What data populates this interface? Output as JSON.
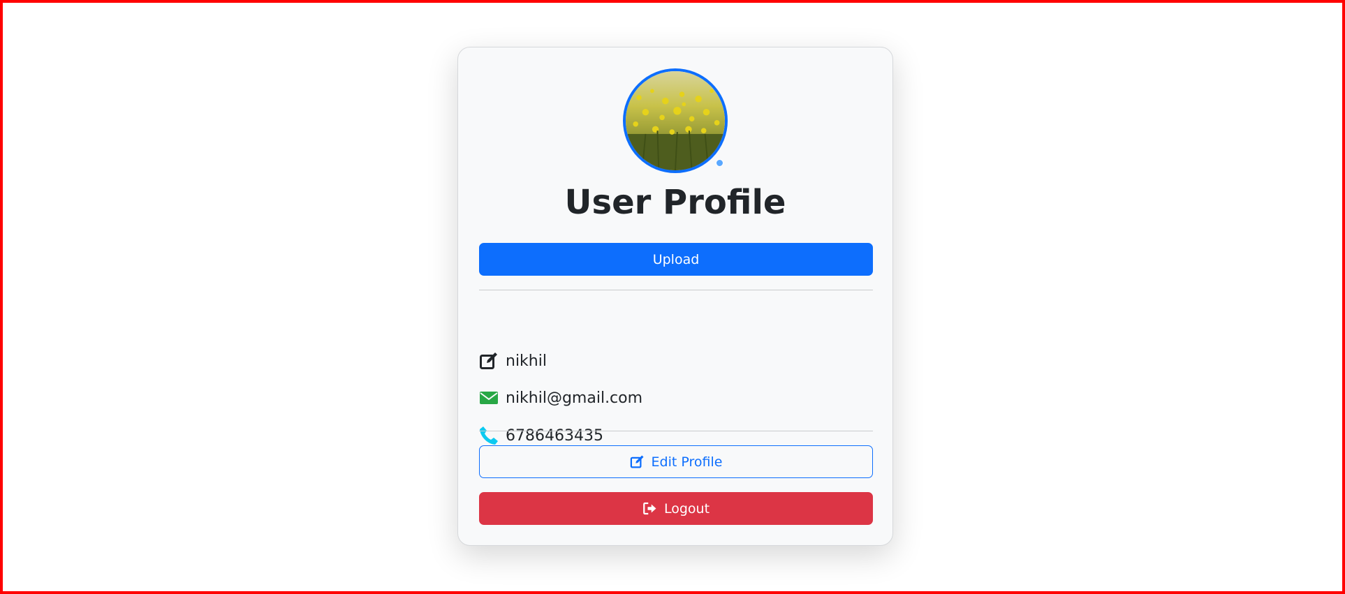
{
  "profile": {
    "title": "User Profile",
    "upload_label": "Upload",
    "name": "nikhil",
    "email": "nikhil@gmail.com",
    "phone": "6786463435",
    "edit_label": "Edit Profile",
    "logout_label": "Logout"
  },
  "colors": {
    "primary": "#0d6efd",
    "danger": "#dc3545",
    "success": "#28a745",
    "info": "#0dcaf0",
    "page_border": "#ff0000"
  },
  "icons": {
    "name": "edit-icon",
    "email": "envelope-icon",
    "phone": "phone-icon",
    "edit_button": "edit-icon",
    "logout_button": "sign-out-icon"
  }
}
